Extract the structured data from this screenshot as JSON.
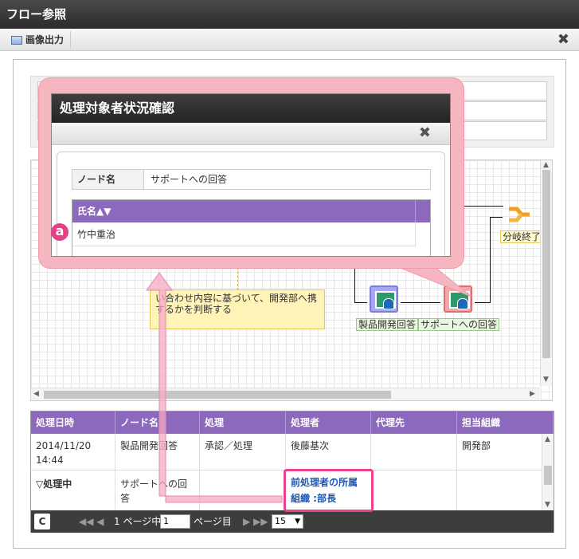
{
  "window": {
    "title": "フロー参照"
  },
  "toolbar": {
    "export_label": "画像出力",
    "close_glyph": "✖"
  },
  "flow": {
    "comment": "い合わせ内容に基づいて、開発部へ携するかを判断する",
    "nodes": [
      {
        "label": "製品開発回答"
      },
      {
        "label": "サポートへの回答"
      }
    ],
    "branch_label": "分岐終了"
  },
  "history_grid": {
    "columns": [
      "処理日時",
      "ノード名",
      "処理",
      "処理者",
      "代理先",
      "担当組織"
    ],
    "rows": [
      {
        "date": "2014/11/20",
        "time": "14:44",
        "node": "製品開発回答",
        "action": "承認／処理",
        "actor": "後藤基次",
        "proxy": "",
        "org": "開発部"
      },
      {
        "date": "▽処理中",
        "time": "",
        "node": "サポートへの回答",
        "action": "",
        "actor": "",
        "proxy": "",
        "org": ""
      }
    ],
    "highlight": {
      "line1": "前処理者の所属",
      "line2": "組織 :部長"
    }
  },
  "pager": {
    "refresh_glyph": "C",
    "first_prev": "◀◀  ◀",
    "page_prefix": "1 ページ中",
    "page_input": "1",
    "page_suffix": "ページ目",
    "next_last": "▶  ▶▶",
    "per_page": "15"
  },
  "dialog": {
    "title": "処理対象者状況確認",
    "close_glyph": "✖",
    "node_label": "ノード名",
    "node_value": "サポートへの回答",
    "column_header": "氏名▲▼",
    "rows": [
      "竹中重治"
    ],
    "badge": "a"
  },
  "colors": {
    "grid_header": "#8c69bd",
    "highlight": "#e9418a",
    "callout": "#f6b6c0"
  }
}
